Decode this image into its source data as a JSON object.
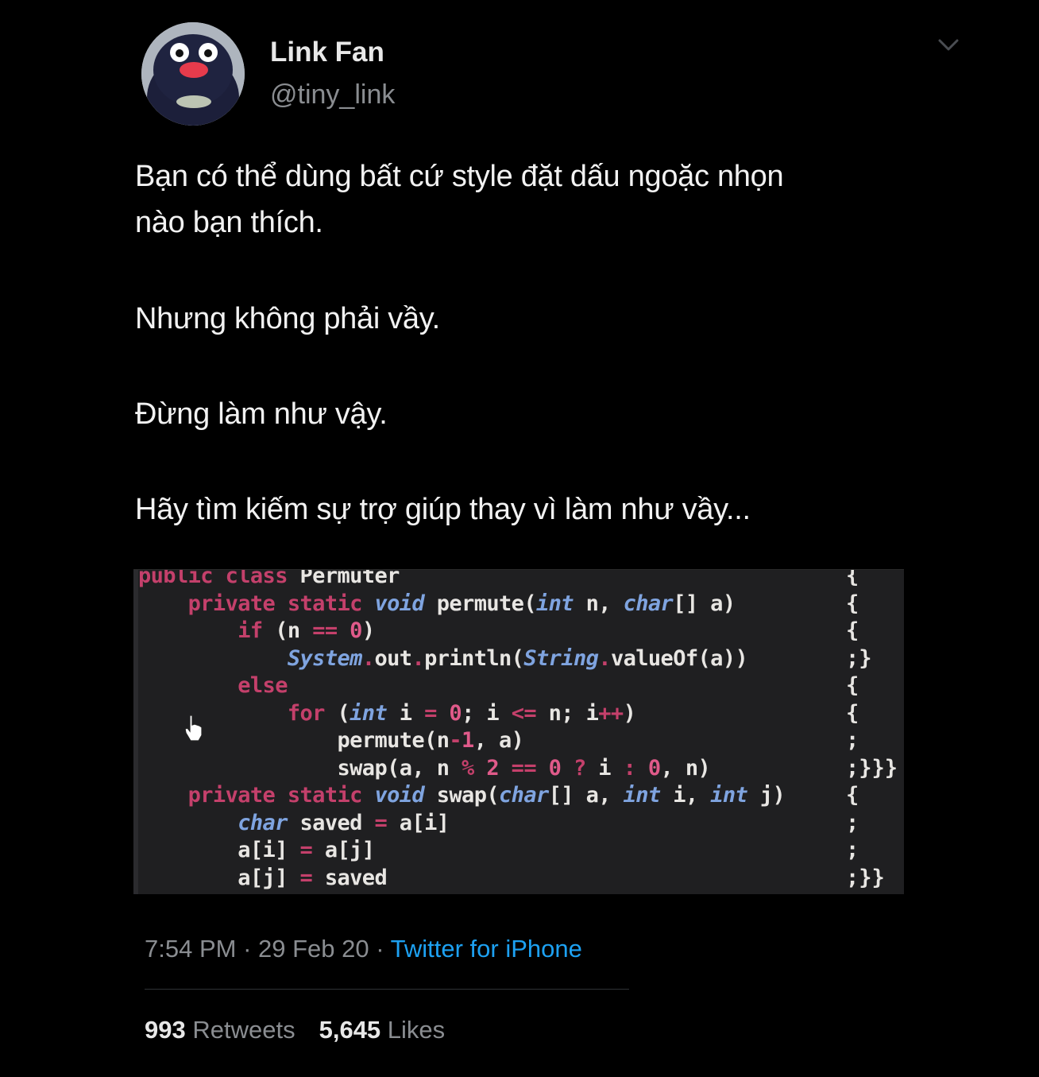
{
  "author": {
    "name": "Link Fan",
    "handle": "@tiny_link"
  },
  "tweet": {
    "paragraphs": [
      "Bạn có thể dùng bất cứ style đặt dấu ngoặc nhọn",
      "nào bạn thích.",
      "Nhưng không phải vầy.",
      "Đừng làm như vậy.",
      "Hãy tìm kiếm sự trợ giúp thay vì làm như vầy..."
    ]
  },
  "code_image": {
    "lines": [
      "public class Permuter",
      "    private static void permute(int n, char[] a)",
      "        if (n == 0)",
      "            System.out.println(String.valueOf(a))",
      "        else",
      "            for (int i = 0; i <= n; i++)",
      "                permute(n-1, a)",
      "                swap(a, n % 2 == 0 ? i : 0, n)",
      "    private static void swap(char[] a, int i, int j)",
      "        char saved = a[i]",
      "        a[i] = a[j]",
      "        a[j] = saved"
    ],
    "braces": [
      "{",
      "{",
      "{",
      ";}",
      "{",
      "{",
      ";",
      ";}}}",
      "{",
      ";",
      ";",
      ";}}"
    ]
  },
  "meta": {
    "time": "7:54 PM",
    "sep1": " · ",
    "date": "29 Feb 20",
    "sep2": " · ",
    "source": "Twitter for iPhone"
  },
  "stats": {
    "retweets_count": "993",
    "retweets_label": "Retweets",
    "likes_count": "5,645",
    "likes_label": "Likes"
  },
  "colors": {
    "background": "#000000",
    "link": "#1da1f2",
    "muted": "#8a8d91"
  },
  "icons": [
    "avatar-penguin",
    "chevron-down-icon",
    "hand-cursor-icon"
  ]
}
